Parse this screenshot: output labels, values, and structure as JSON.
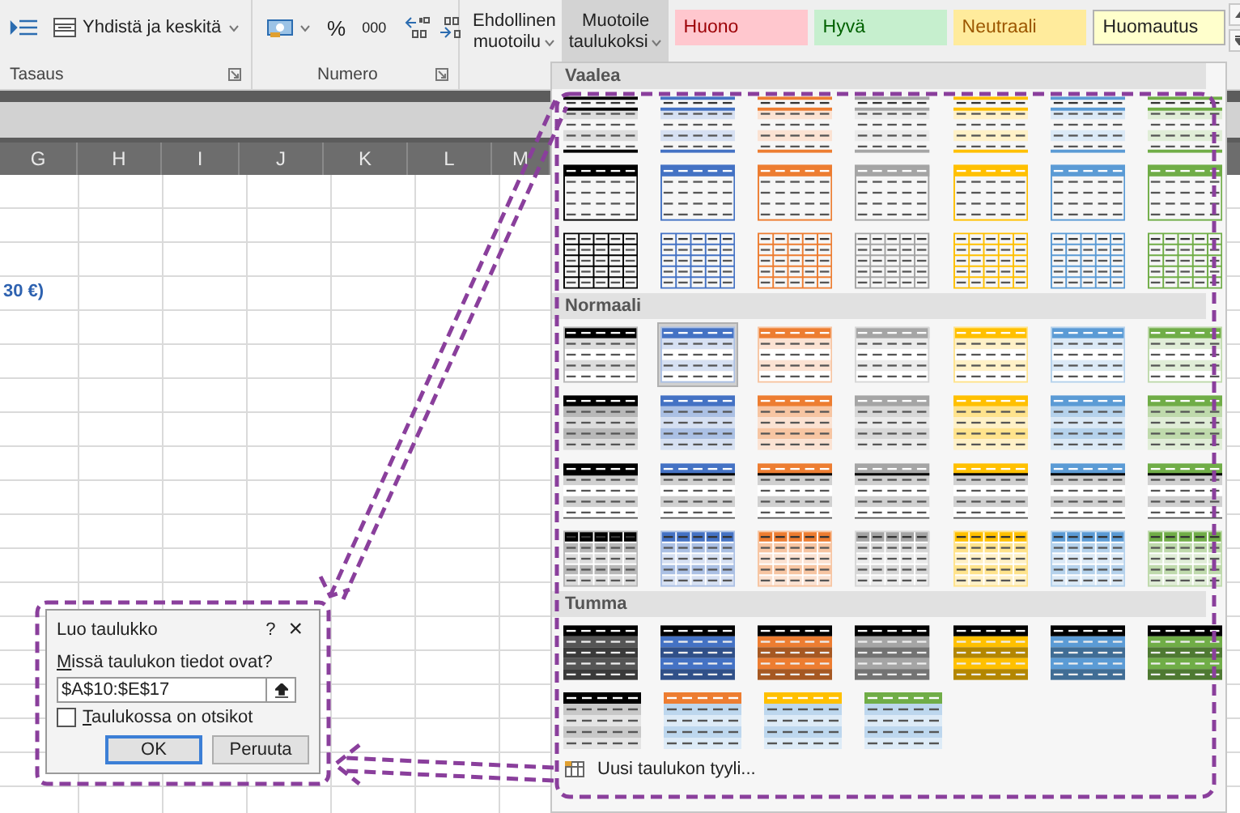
{
  "ribbon": {
    "merge_button": "Yhdistä ja keskitä",
    "alignment_label": "Tasaus",
    "percent_button": "%",
    "thousands_button": "000",
    "number_label": "Numero",
    "commands": [
      {
        "lines": [
          "Ehdollinen",
          "muotoilu"
        ],
        "pressed": false
      },
      {
        "lines": [
          "Muotoile",
          "taulukoksi"
        ],
        "pressed": true
      }
    ],
    "cell_styles": [
      {
        "label": "Huono",
        "kind": "bad"
      },
      {
        "label": "Hyvä",
        "kind": "good"
      },
      {
        "label": "Neutraali",
        "kind": "neutral"
      },
      {
        "label": "Huomautus",
        "kind": "note"
      }
    ]
  },
  "sheet": {
    "columns": [
      "G",
      "H",
      "I",
      "J",
      "K",
      "L",
      "M"
    ],
    "cell_text": "30 €)"
  },
  "gallery": {
    "sections": [
      {
        "title": "Vaalea",
        "rows": [
          {
            "kind": "light-banded",
            "items": [
              {
                "color": "#000000",
                "selected": false
              },
              {
                "color": "#4472c4",
                "selected": false
              },
              {
                "color": "#ed7d31",
                "selected": false
              },
              {
                "color": "#a5a5a5",
                "selected": false
              },
              {
                "color": "#ffc000",
                "selected": false
              },
              {
                "color": "#5b9bd5",
                "selected": false
              },
              {
                "color": "#70ad47",
                "selected": false
              }
            ]
          },
          {
            "kind": "light-header",
            "items": [
              {
                "color": "#000000",
                "selected": false
              },
              {
                "color": "#4472c4",
                "selected": false
              },
              {
                "color": "#ed7d31",
                "selected": false
              },
              {
                "color": "#a5a5a5",
                "selected": false
              },
              {
                "color": "#ffc000",
                "selected": false
              },
              {
                "color": "#5b9bd5",
                "selected": false
              },
              {
                "color": "#70ad47",
                "selected": false
              }
            ]
          },
          {
            "kind": "light-grid",
            "items": [
              {
                "color": "#000000",
                "selected": false
              },
              {
                "color": "#4472c4",
                "selected": false
              },
              {
                "color": "#ed7d31",
                "selected": false
              },
              {
                "color": "#a5a5a5",
                "selected": false
              },
              {
                "color": "#ffc000",
                "selected": false
              },
              {
                "color": "#5b9bd5",
                "selected": false
              },
              {
                "color": "#70ad47",
                "selected": false
              }
            ]
          }
        ]
      },
      {
        "title": "Normaali",
        "rows": [
          {
            "kind": "medium-banded",
            "items": [
              {
                "color": "#000000",
                "selected": false
              },
              {
                "color": "#4472c4",
                "selected": true
              },
              {
                "color": "#ed7d31",
                "selected": false
              },
              {
                "color": "#a5a5a5",
                "selected": false
              },
              {
                "color": "#ffc000",
                "selected": false
              },
              {
                "color": "#5b9bd5",
                "selected": false
              },
              {
                "color": "#70ad47",
                "selected": false
              }
            ]
          },
          {
            "kind": "medium-tinted",
            "items": [
              {
                "color": "#000000",
                "selected": false
              },
              {
                "color": "#4472c4",
                "selected": false
              },
              {
                "color": "#ed7d31",
                "selected": false
              },
              {
                "color": "#a5a5a5",
                "selected": false
              },
              {
                "color": "#ffc000",
                "selected": false
              },
              {
                "color": "#5b9bd5",
                "selected": false
              },
              {
                "color": "#70ad47",
                "selected": false
              }
            ]
          },
          {
            "kind": "medium-bars",
            "items": [
              {
                "color": "#000000",
                "selected": false
              },
              {
                "color": "#4472c4",
                "selected": false
              },
              {
                "color": "#ed7d31",
                "selected": false
              },
              {
                "color": "#a5a5a5",
                "selected": false
              },
              {
                "color": "#ffc000",
                "selected": false
              },
              {
                "color": "#5b9bd5",
                "selected": false
              },
              {
                "color": "#70ad47",
                "selected": false
              }
            ]
          },
          {
            "kind": "medium-grid",
            "items": [
              {
                "color": "#000000",
                "selected": false
              },
              {
                "color": "#4472c4",
                "selected": false
              },
              {
                "color": "#ed7d31",
                "selected": false
              },
              {
                "color": "#a5a5a5",
                "selected": false
              },
              {
                "color": "#ffc000",
                "selected": false
              },
              {
                "color": "#5b9bd5",
                "selected": false
              },
              {
                "color": "#70ad47",
                "selected": false
              }
            ]
          }
        ]
      },
      {
        "title": "Tumma",
        "rows": [
          {
            "kind": "dark",
            "items": [
              {
                "color": "#000000",
                "selected": false
              },
              {
                "color": "#4472c4",
                "selected": false
              },
              {
                "color": "#ed7d31",
                "selected": false
              },
              {
                "color": "#a5a5a5",
                "selected": false
              },
              {
                "color": "#ffc000",
                "selected": false
              },
              {
                "color": "#5b9bd5",
                "selected": false
              },
              {
                "color": "#70ad47",
                "selected": false
              }
            ]
          },
          {
            "kind": "dark-header",
            "items": [
              {
                "color": "#000000",
                "selected": false
              },
              {
                "color": "#ed7d31",
                "selected": false
              },
              {
                "color": "#ffc000",
                "selected": false
              },
              {
                "color": "#70ad47",
                "selected": false
              }
            ]
          }
        ]
      }
    ],
    "footer": "Uusi taulukon tyyli..."
  },
  "dialog": {
    "title": "Luo taulukko",
    "help": "?",
    "close": "×",
    "range_label": "Missä taulukon tiedot ovat?",
    "range_value": "$A$10:$E$17",
    "headers_checkbox": {
      "label": "Taulukossa on otsikot",
      "checked": false
    },
    "buttons": [
      {
        "label": "OK",
        "default": true
      },
      {
        "label": "Peruuta",
        "default": false
      }
    ]
  }
}
